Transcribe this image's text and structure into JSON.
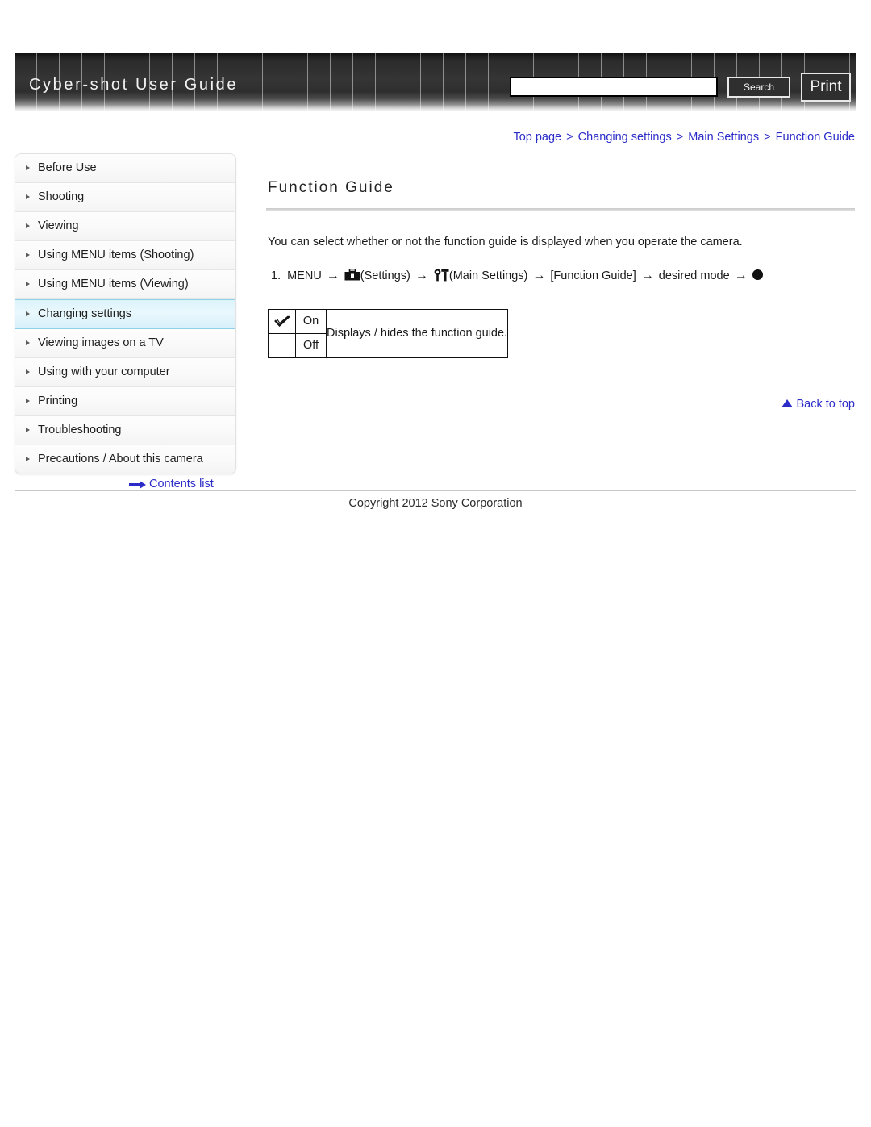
{
  "header": {
    "brand_title": "Cyber-shot User Guide",
    "search": {
      "value": "",
      "placeholder": "",
      "button_label": "Search"
    },
    "print_label": "Print"
  },
  "breadcrumb": {
    "items": [
      {
        "label": "Top page"
      },
      {
        "label": "Changing settings"
      },
      {
        "label": "Main Settings"
      },
      {
        "label": "Function Guide"
      }
    ],
    "separator": ">"
  },
  "sidebar": {
    "items": [
      {
        "label": "Before Use",
        "active": false
      },
      {
        "label": "Shooting",
        "active": false
      },
      {
        "label": "Viewing",
        "active": false
      },
      {
        "label": "Using MENU items (Shooting)",
        "active": false
      },
      {
        "label": "Using MENU items (Viewing)",
        "active": false
      },
      {
        "label": "Changing settings",
        "active": true
      },
      {
        "label": "Viewing images on a TV",
        "active": false
      },
      {
        "label": "Using with your computer",
        "active": false
      },
      {
        "label": "Printing",
        "active": false
      },
      {
        "label": "Troubleshooting",
        "active": false
      },
      {
        "label": "Precautions / About this camera",
        "active": false
      }
    ],
    "contents_list_label": "Contents list"
  },
  "main": {
    "title": "Function Guide",
    "intro": "You can select whether or not the function guide is displayed when you operate the camera.",
    "step": {
      "number": "1.",
      "menu_label": "MENU",
      "settings_label": "(Settings)",
      "main_settings_label": "(Main Settings)",
      "function_guide_label": "[Function Guide]",
      "desired_mode_label": "desired mode",
      "arrow": "→"
    },
    "option_table": {
      "rows": [
        {
          "checked": true,
          "label": "On"
        },
        {
          "checked": false,
          "label": "Off"
        }
      ],
      "description": "Displays / hides the function guide."
    },
    "back_to_top_label": "Back to top"
  },
  "footer": {
    "copyright": "Copyright 2012 Sony Corporation"
  },
  "colors": {
    "link": "#2c2cc9",
    "active_nav": "#ddf3fb",
    "header_dark": "#2f2f2f"
  }
}
